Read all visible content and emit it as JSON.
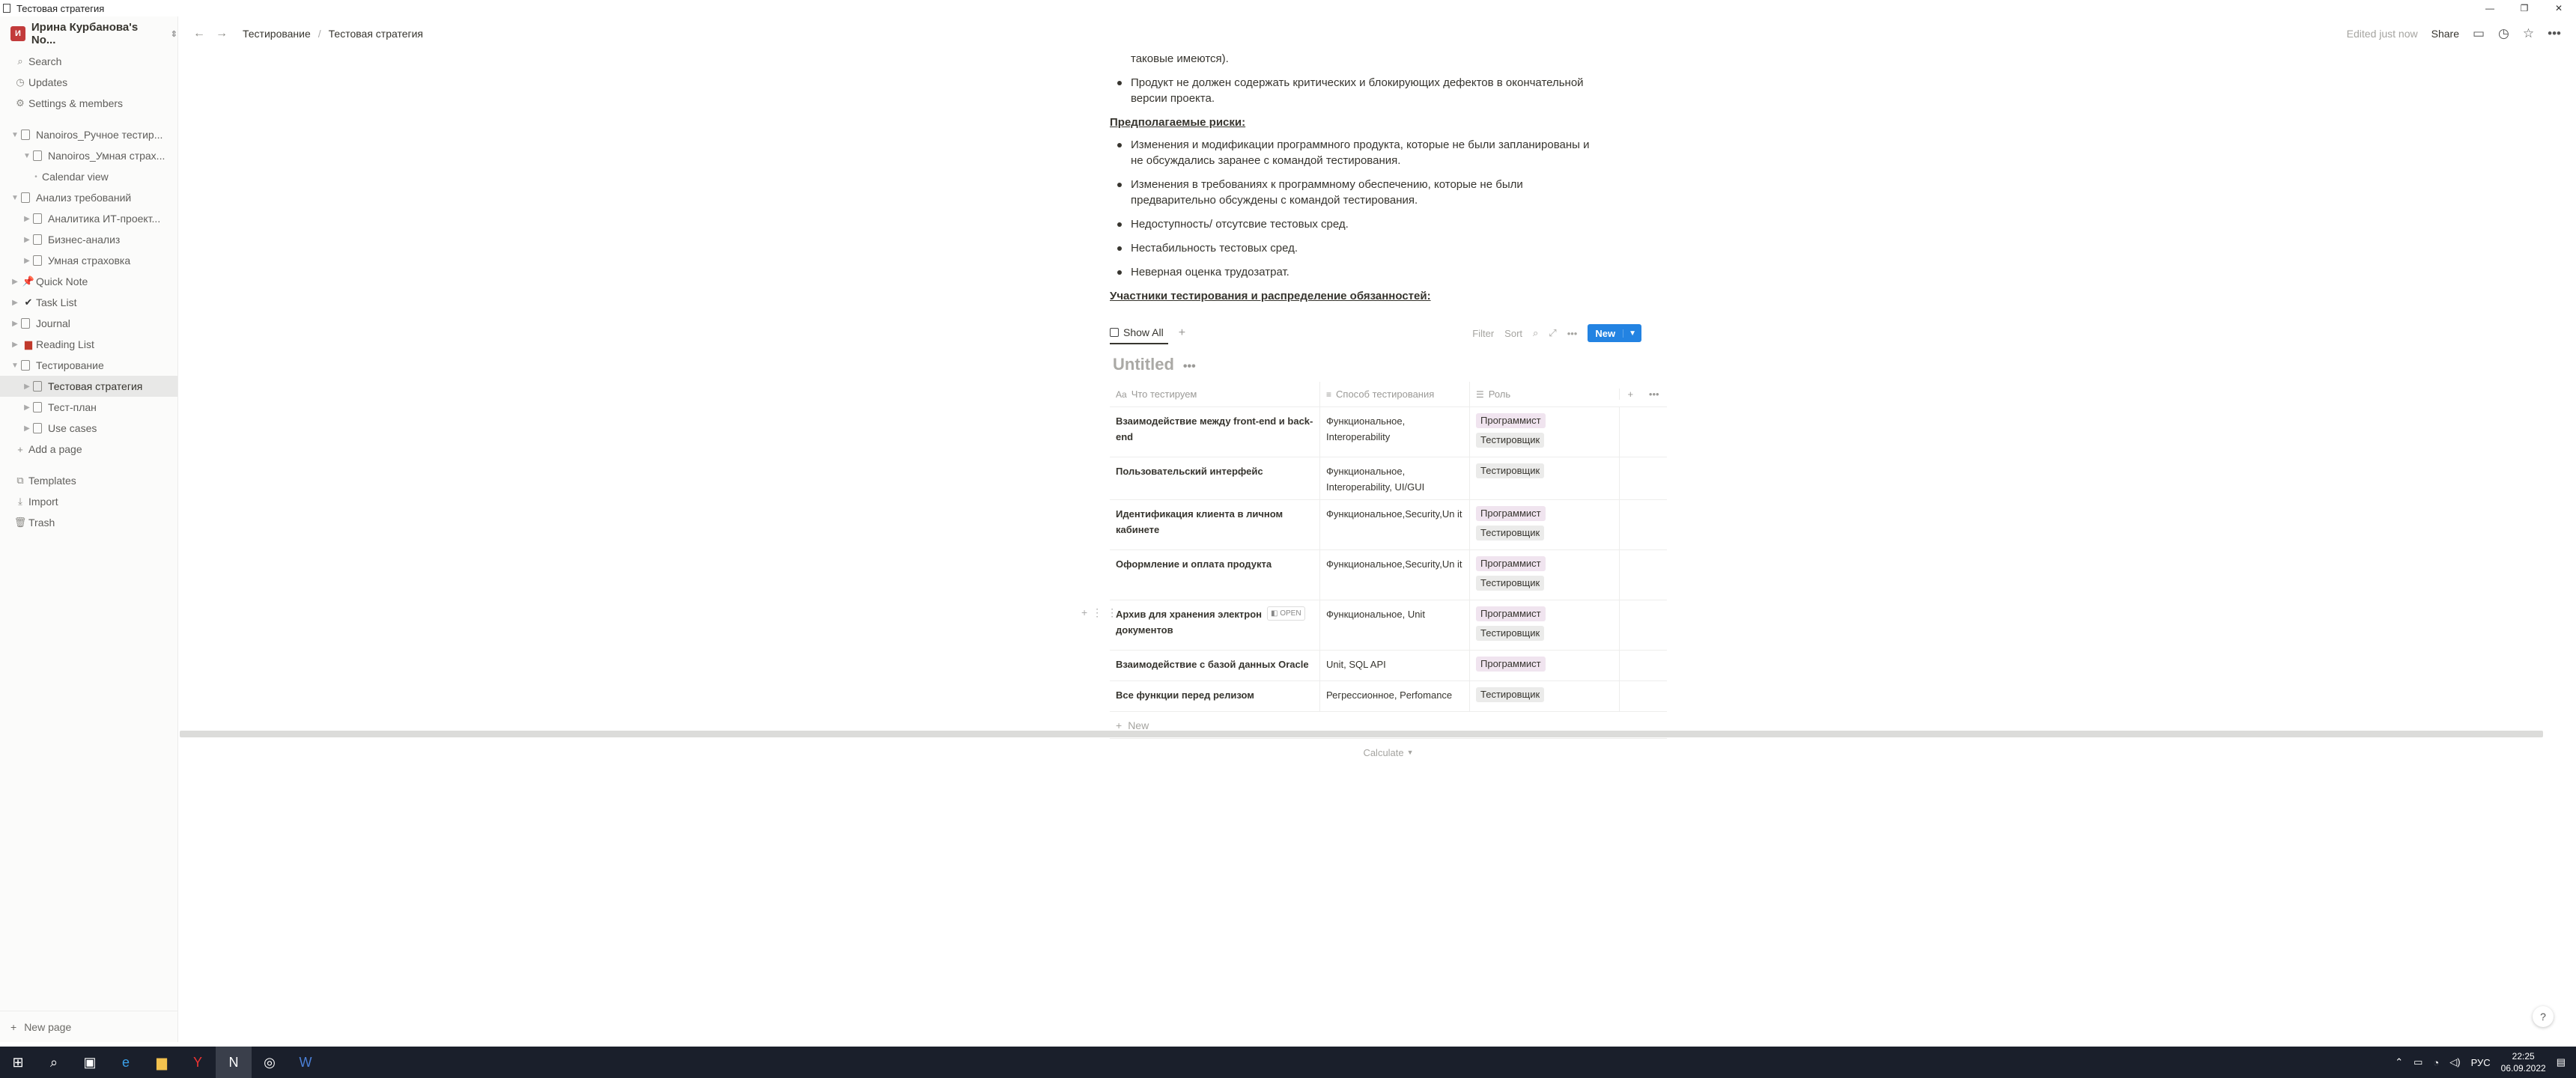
{
  "window": {
    "title": "Тестовая стратегия"
  },
  "sidebar": {
    "workspace": "Ирина Курбанова's No...",
    "workspace_initial": "И",
    "search": "Search",
    "updates": "Updates",
    "settings": "Settings & members",
    "tree": {
      "i0": "Nanoiros_Ручное тестир...",
      "i1": "Nanoiros_Умная страх...",
      "i2": "Calendar view",
      "i3": "Анализ требований",
      "i4": "Аналитика ИТ-проект...",
      "i5": "Бизнес-анализ",
      "i6": "Умная страховка",
      "i7": "Quick Note",
      "i8": "Task List",
      "i9": "Journal",
      "i10": "Reading List",
      "i11": "Тестирование",
      "i12": "Тестовая стратегия",
      "i13": "Тест-план",
      "i14": "Use cases"
    },
    "add_page": "Add a page",
    "templates": "Templates",
    "import": "Import",
    "trash": "Trash",
    "new_page": "New page"
  },
  "topbar": {
    "crumb1": "Тестирование",
    "crumb2": "Тестовая стратегия",
    "edited": "Edited just now",
    "share": "Share"
  },
  "content": {
    "b0": "таковые имеются).",
    "b1a": "Продукт не должен содержать критических и блокирующих дефектов в окончательной",
    "b1b": "версии проекта.",
    "h1": "Предполагаемые риски:",
    "r1a": "Изменения и модификации программного продукта, которые не были запланированы и",
    "r1b": "не обсуждались заранее с командой тестирования.",
    "r2a": "Изменения в требованиях к программному обеспечению, которые не были",
    "r2b": "предварительно обсуждены с командой тестирования.",
    "r3": "Недоступность/ отсутсвие тестовых сред.",
    "r4": "Нестабильность тестовых сред.",
    "r5": "Неверная оценка трудозатрат.",
    "h2": "Участники тестирования и распределение обязанностей:"
  },
  "database": {
    "view_tab": "Show All",
    "filter": "Filter",
    "sort": "Sort",
    "new": "New",
    "title": "Untitled",
    "columns": {
      "c1": "Что тестируем",
      "c2": "Способ тестирования",
      "c3": "Роль"
    },
    "rows": [
      {
        "what": "Взаимодействие между front-end и back-end",
        "how": "Функциональное, Interoperability",
        "roles": [
          "Программист",
          "Тестировщик"
        ]
      },
      {
        "what": "Пользовательский интерфейс",
        "how": "Функциональное, Interoperability, UI/GUI",
        "roles": [
          "Тестировщик"
        ]
      },
      {
        "what": "Идентификация клиента в личном кабинете",
        "how": "Функциональное,Security,Un it",
        "roles": [
          "Программист",
          "Тестировщик"
        ]
      },
      {
        "what": "Оформление и оплата продукта",
        "how": "Функциональное,Security,Un it",
        "roles": [
          "Программист",
          "Тестировщик"
        ]
      },
      {
        "what": "Архив для хранения электрон документов",
        "how": "Функциональное, Unit",
        "roles": [
          "Программист",
          "Тестировщик"
        ]
      },
      {
        "what": "Взаимодействие с базой данных Oracle",
        "how": "Unit, SQL API",
        "roles": [
          "Программист"
        ]
      },
      {
        "what": "Все функции перед релизом",
        "how": "Регрессионное, Perfomance",
        "roles": [
          "Тестировщик"
        ]
      }
    ],
    "open_label": "OPEN",
    "new_row": "New",
    "calculate": "Calculate"
  },
  "taskbar": {
    "lang": "РУС",
    "time": "22:25",
    "date": "06.09.2022"
  },
  "colors": {
    "accent": "#2383e2",
    "tag_programmer": "#f0e4ef",
    "tag_tester": "#ebebea"
  }
}
